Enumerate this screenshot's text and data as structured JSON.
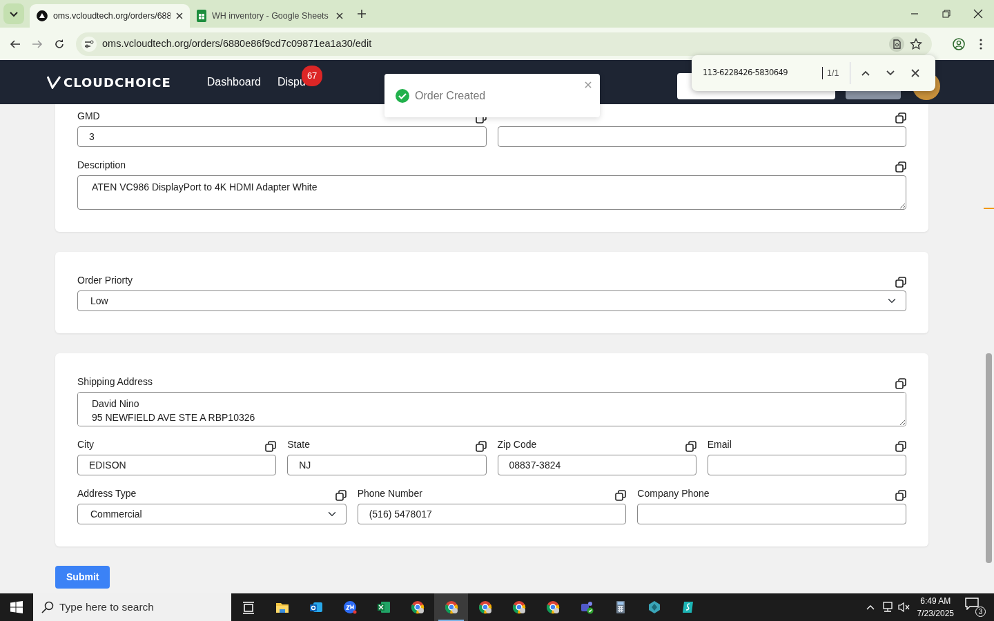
{
  "browser": {
    "tabs": [
      {
        "title": "oms.vcloudtech.org/orders/688",
        "selected": true,
        "kind": "site"
      },
      {
        "title": "WH inventory - Google Sheets",
        "selected": false,
        "kind": "sheets"
      }
    ],
    "address": "oms.vcloudtech.org/orders/6880e86f9cd7c09871ea1a30/edit",
    "find": {
      "query": "113-6228426-5830649",
      "count": "1/1"
    }
  },
  "app": {
    "logo": "CLOUDCHOICE",
    "nav": [
      {
        "label": "Dashboard"
      },
      {
        "label": "Dispu",
        "badge": "67"
      }
    ]
  },
  "toast": {
    "message": "Order Created"
  },
  "sections": [
    {
      "rows": [
        [
          {
            "label": "GMD",
            "kind": "input",
            "value": "3"
          },
          {
            "kind": "input"
          }
        ],
        [
          {
            "label": "Description",
            "kind": "textarea",
            "value": "ATEN VC986 DisplayPort to 4K HDMI Adapter White"
          }
        ]
      ]
    },
    {
      "rows": [
        [
          {
            "label": "Order Priorty",
            "kind": "select",
            "value": "Low"
          }
        ]
      ]
    },
    {
      "rows": [
        [
          {
            "label": "Shipping Address",
            "kind": "textarea",
            "value": "David Nino\n95 NEWFIELD AVE STE A RBP10326"
          }
        ],
        [
          {
            "label": "City",
            "kind": "input",
            "value": "EDISON"
          },
          {
            "label": "State",
            "kind": "input",
            "value": "NJ"
          },
          {
            "label": "Zip Code",
            "kind": "input",
            "value": "08837-3824"
          },
          {
            "label": "Email",
            "kind": "input"
          }
        ],
        [
          {
            "label": "Address Type",
            "kind": "select",
            "value": "Commercial"
          },
          {
            "label": "Phone Number",
            "kind": "input",
            "value": "(516) 5478017"
          },
          {
            "label": "Company Phone",
            "kind": "input"
          }
        ]
      ]
    }
  ],
  "submit": "Submit",
  "taskbar": {
    "search_placeholder": "Type here to search",
    "apps": [
      {
        "kind": "taskview",
        "selected": false
      },
      {
        "kind": "folder",
        "selected": false
      },
      {
        "kind": "mail",
        "selected": false
      },
      {
        "kind": "zoom",
        "selected": false
      },
      {
        "kind": "excel",
        "selected": false
      },
      {
        "kind": "chrome",
        "selected": false
      },
      {
        "kind": "chrome",
        "selected": true
      },
      {
        "kind": "chrome",
        "selected": false
      },
      {
        "kind": "chrome",
        "selected": false
      },
      {
        "kind": "chrome",
        "selected": false
      },
      {
        "kind": "teams",
        "selected": false
      },
      {
        "kind": "calculator",
        "selected": false
      },
      {
        "kind": "cube",
        "selected": false
      },
      {
        "kind": "surf",
        "selected": false
      }
    ],
    "time": "6:49 AM",
    "date": "7/23/2025",
    "notifications": "3"
  }
}
